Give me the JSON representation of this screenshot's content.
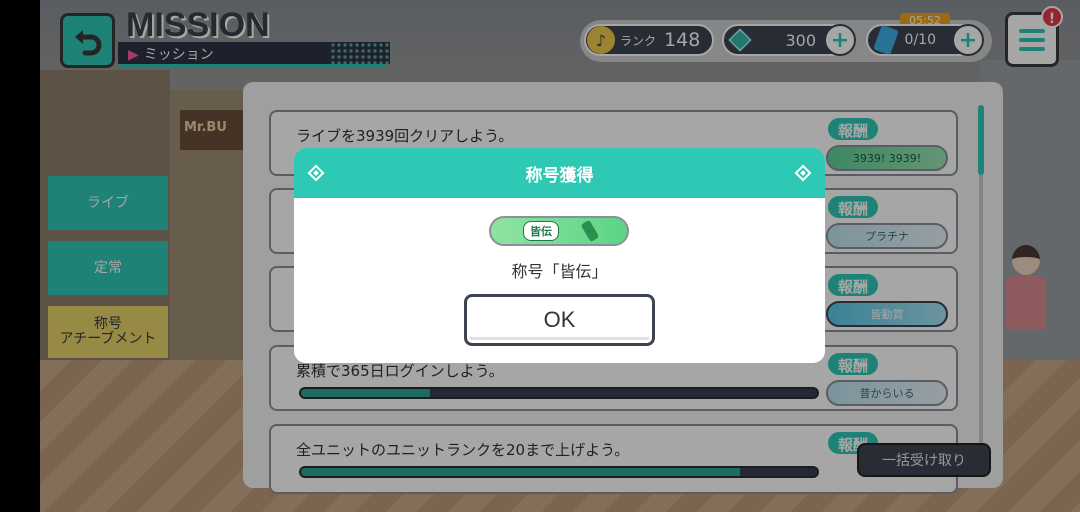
{
  "header": {
    "title": "MISSION",
    "subtitle": "ミッション"
  },
  "status": {
    "rank_label": "ランク",
    "rank_value": "148",
    "gems": "300",
    "tickets": "0/10",
    "timer": "05:52",
    "notification": "!"
  },
  "tabs": [
    {
      "label": "ライブ"
    },
    {
      "label": "定常"
    },
    {
      "label": "称号\nアチーブメント"
    }
  ],
  "missions": [
    {
      "text": "ライブを3939回クリアしよう。",
      "reward_label": "報酬",
      "reward": "3939! 3939!"
    },
    {
      "text": "",
      "reward_label": "報酬",
      "reward": "プラチナ"
    },
    {
      "text": "",
      "reward_label": "報酬",
      "reward": "皆勤賞"
    },
    {
      "text": "累積で365日ログインしよう。",
      "reward_label": "報酬",
      "reward": "昔からいる",
      "progress": 0.25
    },
    {
      "text": "全ユニットのユニットランクを20まで上げよう。",
      "reward_label": "報酬",
      "progress": 0.85
    }
  ],
  "bulk_button": "一括受け取り",
  "dialog": {
    "title": "称号獲得",
    "plate_text": "皆伝",
    "message": "称号「皆伝」",
    "ok": "OK"
  },
  "colors": {
    "accent": "#2ec9b5",
    "dark": "#3e4452",
    "notify": "#e5374b"
  }
}
